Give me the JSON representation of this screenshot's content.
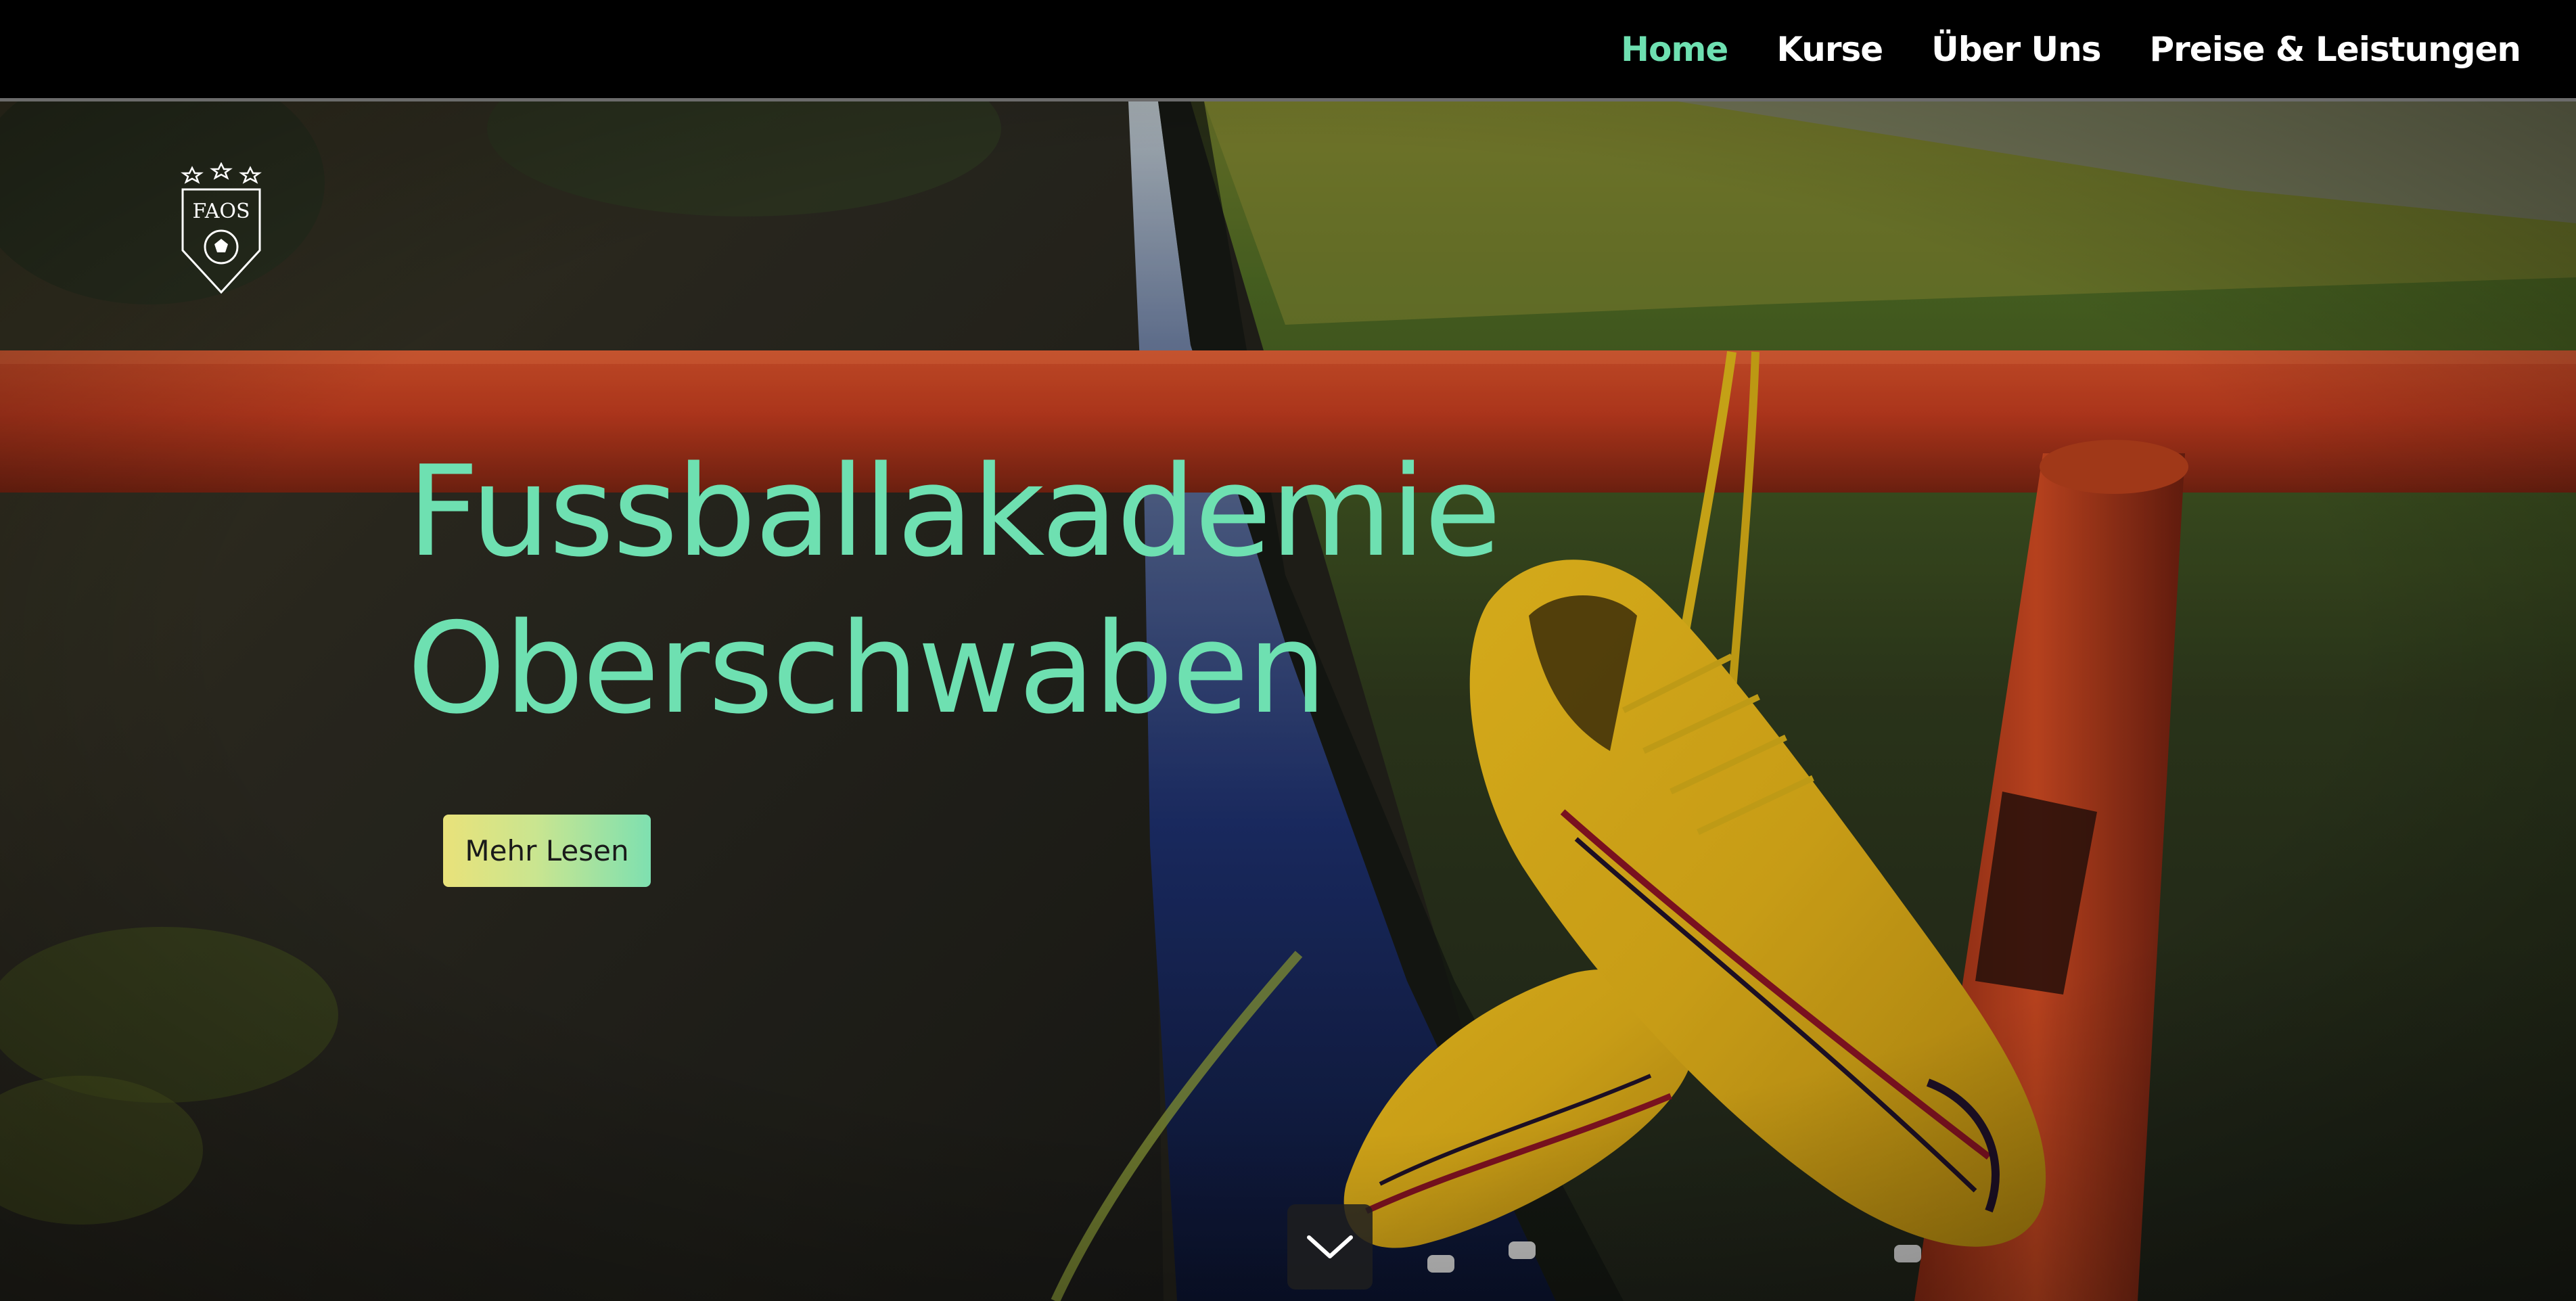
{
  "nav": {
    "items": [
      {
        "label": "Home",
        "active": true
      },
      {
        "label": "Kurse",
        "active": false
      },
      {
        "label": "Über Uns",
        "active": false
      },
      {
        "label": "Preise & Leistungen",
        "active": false
      }
    ]
  },
  "logo": {
    "text": "FAOS",
    "icon": "soccer-crest-icon"
  },
  "hero": {
    "title_line1": "Fussballakademie",
    "title_line2": "Oberschwaben",
    "button_label": "Mehr Lesen",
    "background": "soccer-boots-hanging-on-red-railing-photo",
    "scroll_icon": "chevron-down-icon"
  },
  "colors": {
    "accent": "#6ee0b1",
    "nav_background": "#000000",
    "button_gradient_start": "#e9e27a",
    "button_gradient_end": "#7ee0b0"
  }
}
